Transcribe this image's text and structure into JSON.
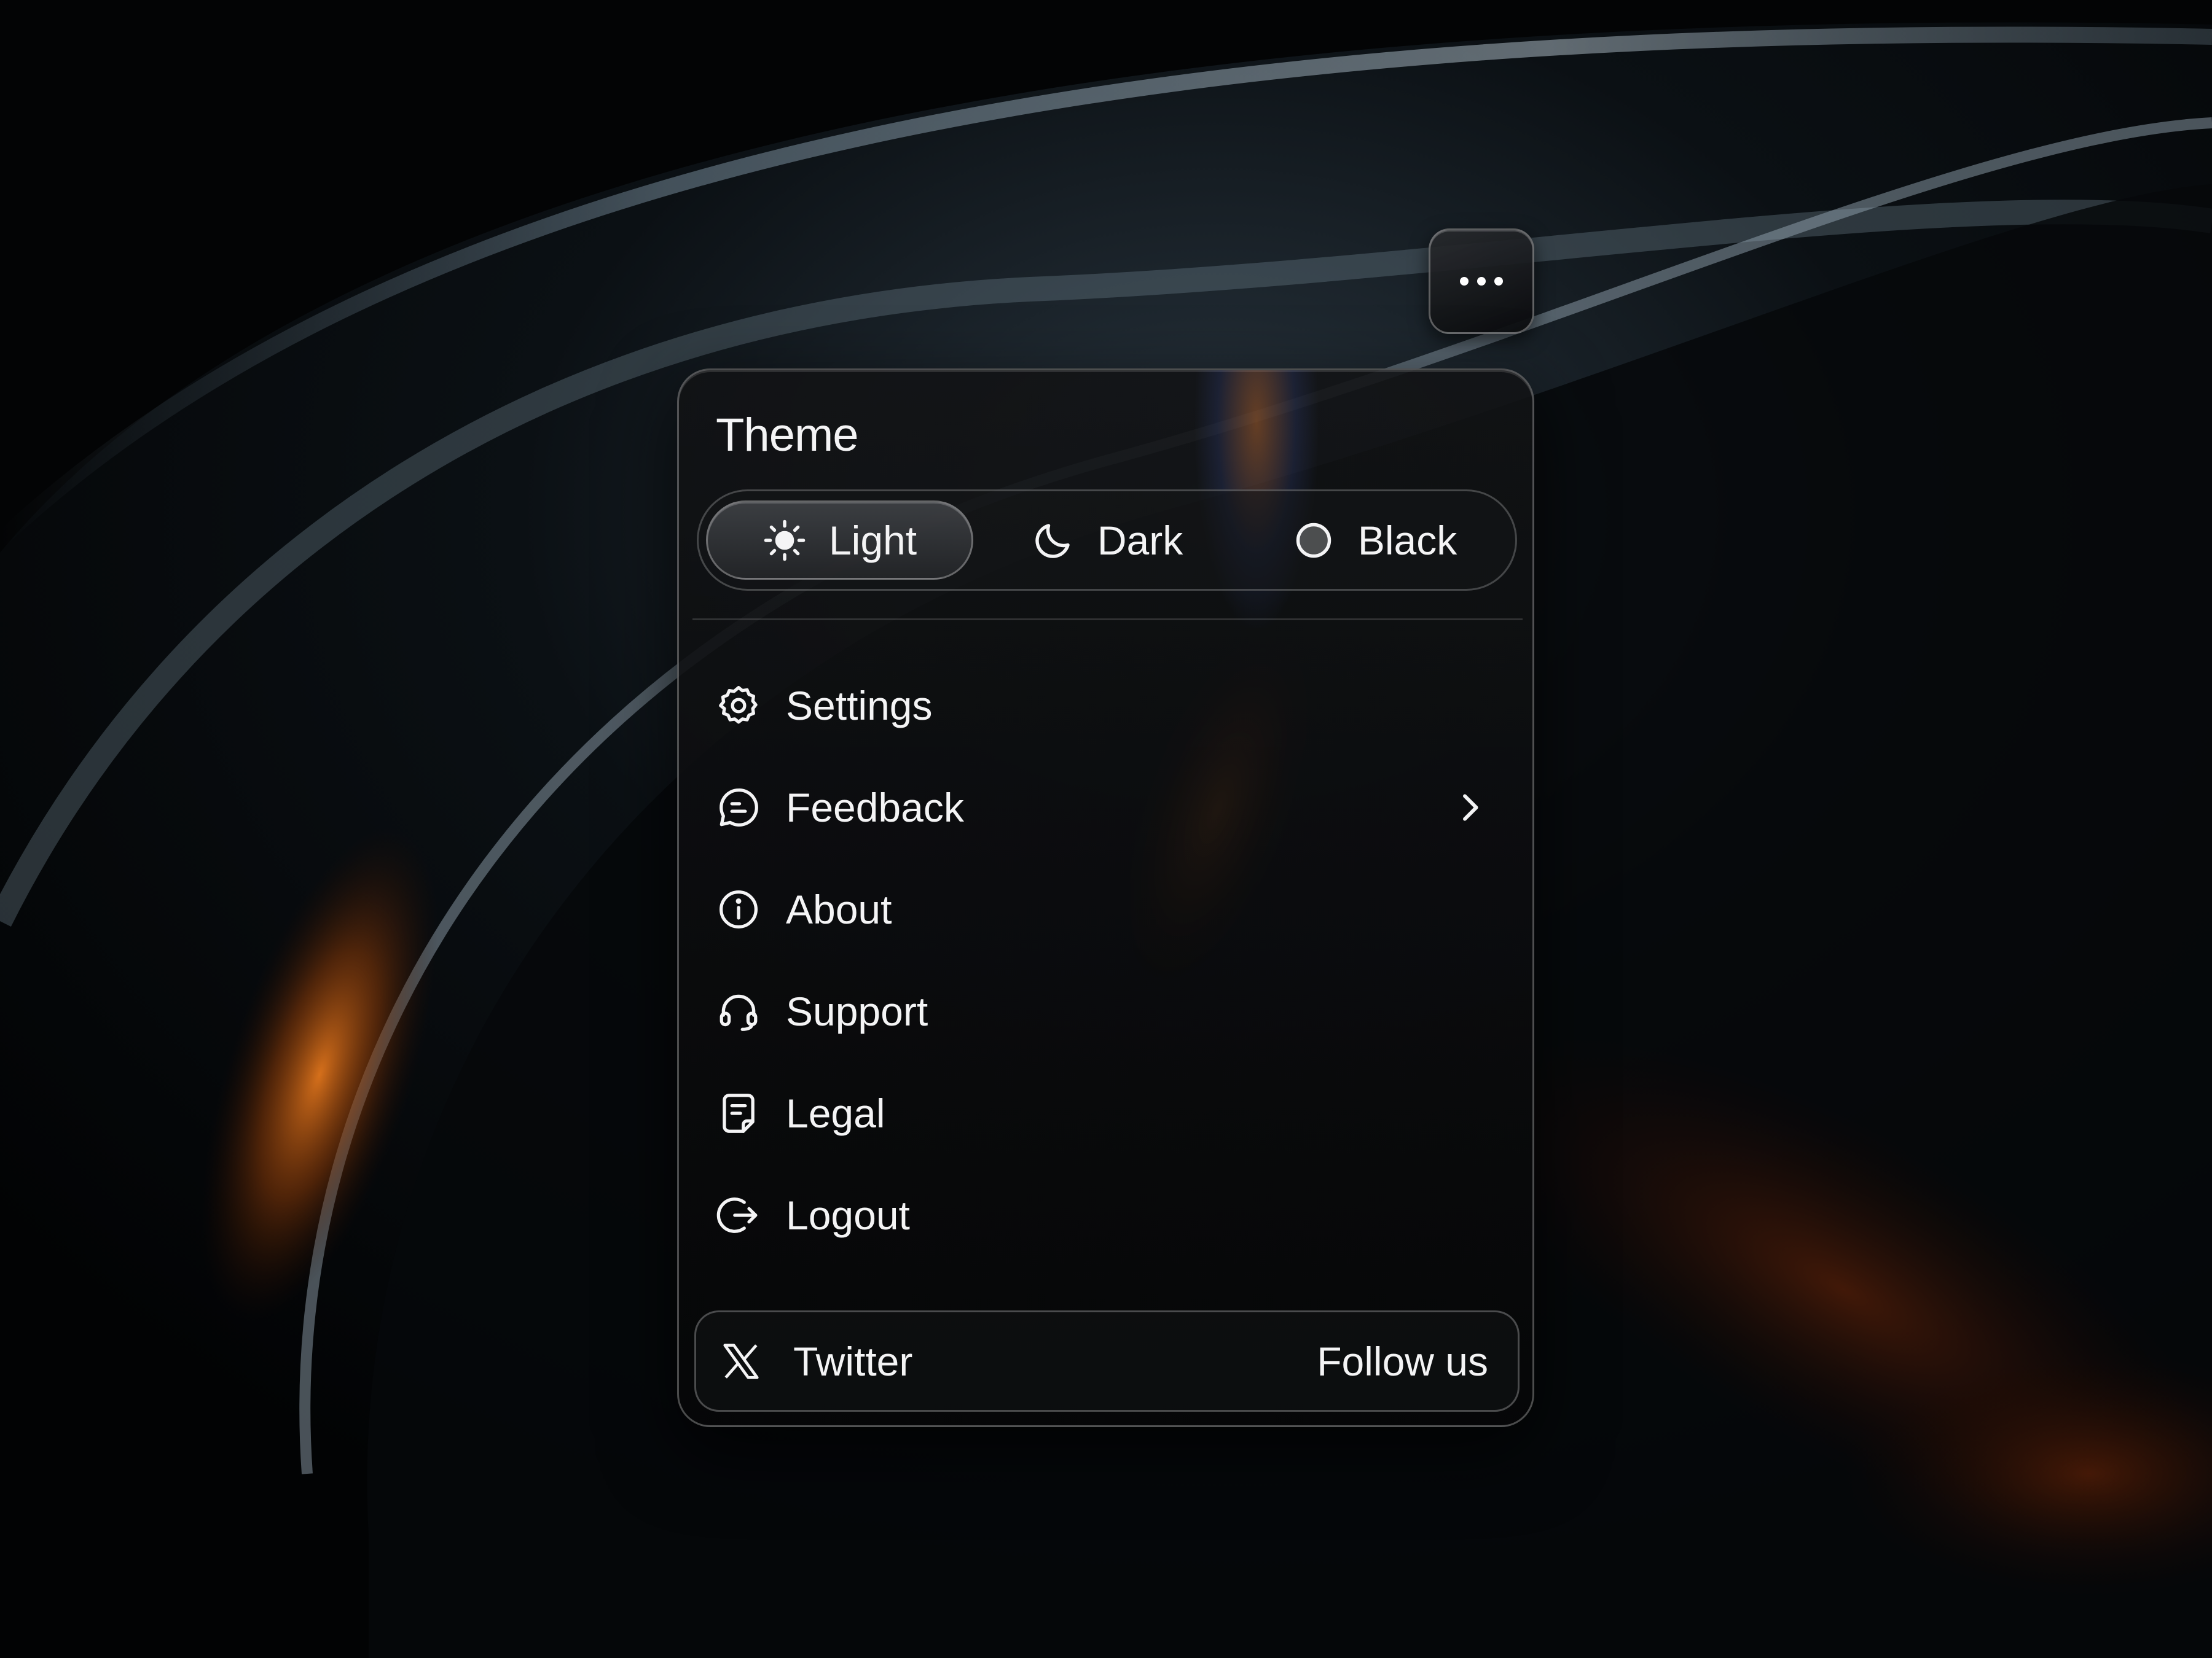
{
  "theme": {
    "title": "Theme",
    "options": [
      {
        "label": "Light",
        "icon": "sun-icon",
        "selected": true
      },
      {
        "label": "Dark",
        "icon": "moon-icon",
        "selected": false
      },
      {
        "label": "Black",
        "icon": "circle-icon",
        "selected": false
      }
    ]
  },
  "menu": {
    "items": [
      {
        "label": "Settings",
        "icon": "gear-icon"
      },
      {
        "label": "Feedback",
        "icon": "chat-bubble-icon",
        "has_submenu": true
      },
      {
        "label": "About",
        "icon": "info-icon"
      },
      {
        "label": "Support",
        "icon": "headset-icon"
      },
      {
        "label": "Legal",
        "icon": "document-icon"
      },
      {
        "label": "Logout",
        "icon": "logout-icon"
      }
    ]
  },
  "footer": {
    "label": "Twitter",
    "action": "Follow us",
    "icon": "x-logo-icon"
  },
  "colors": {
    "background": "#030405",
    "text": "#f4f4f5",
    "accent_glow": "#d46a18"
  }
}
